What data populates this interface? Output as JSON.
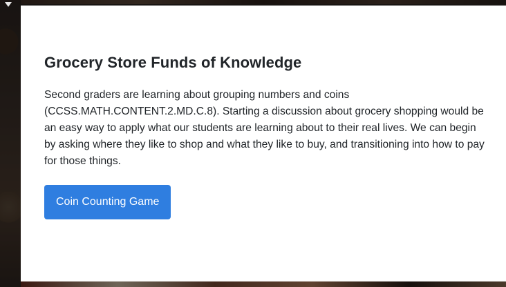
{
  "modal": {
    "title": "Grocery Store Funds of Knowledge",
    "body": "Second graders are learning about grouping numbers and coins (CCSS.MATH.CONTENT.2.MD.C.8). Starting a discussion about grocery shopping would be an easy way to apply what our students are learning about to their real lives. We can begin by asking where they like to shop and what they like to buy, and transitioning into how to pay for those things.",
    "button_label": "Coin Counting Game"
  },
  "colors": {
    "button_bg": "#2f7ee0",
    "modal_bg": "#ffffff",
    "text": "#212529"
  },
  "icons": {
    "top_left": "chevron-down-icon"
  }
}
